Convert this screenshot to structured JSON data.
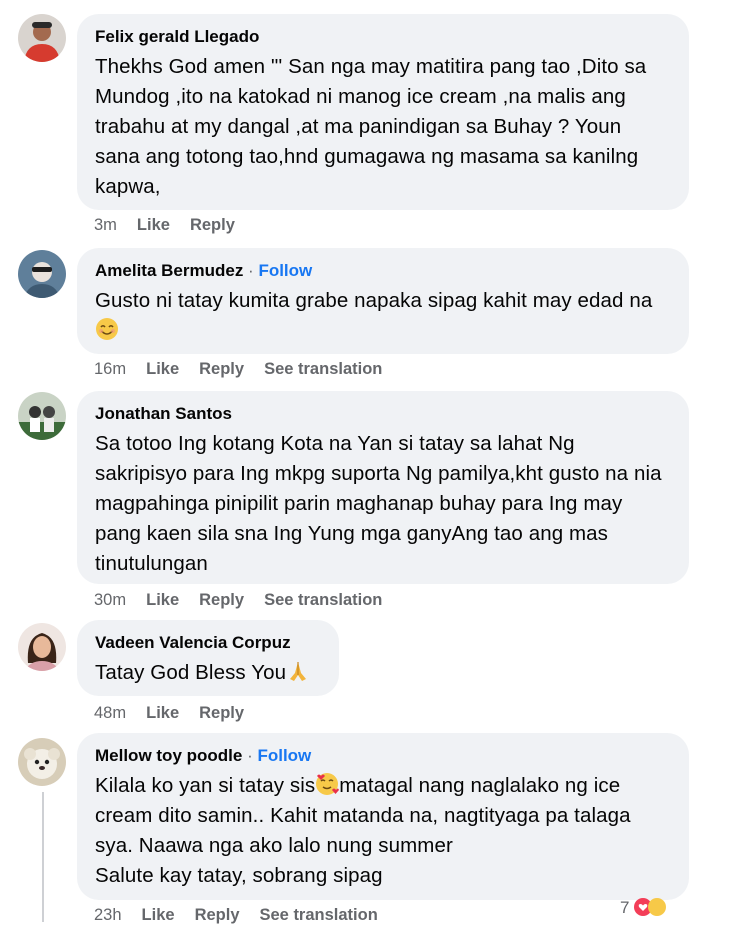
{
  "comments": [
    {
      "author": "Felix gerald Llegado",
      "follow": "",
      "text": "Thekhs God amen \"' San nga may matitira pang tao ,Dito sa Mundog ,ito na katokad ni manog ice cream ,na malis ang trabahu at my dangal ,at ma panindigan sa Buhay ? Youn sana ang totong tao,hnd gumagawa ng masama sa kanilng kapwa,",
      "time": "3m",
      "like": "Like",
      "reply": "Reply",
      "see_translation": ""
    },
    {
      "author": "Amelita Bermudez",
      "follow": "Follow",
      "text": "Gusto ni tatay kumita grabe napaka sipag kahit may edad na",
      "time": "16m",
      "like": "Like",
      "reply": "Reply",
      "see_translation": "See translation"
    },
    {
      "author": "Jonathan Santos",
      "follow": "",
      "text": "Sa totoo Ing kotang Kota na Yan si tatay sa lahat Ng sakripisyo para Ing mkpg suporta Ng pamilya,kht gusto na nia magpahinga pinipilit parin maghanap buhay para Ing may pang kaen sila sna Ing Yung mga ganyAng tao ang mas tinutulungan",
      "time": "30m",
      "like": "Like",
      "reply": "Reply",
      "see_translation": "See translation"
    },
    {
      "author": "Vadeen Valencia Corpuz",
      "follow": "",
      "text": "Tatay God Bless You",
      "time": "48m",
      "like": "Like",
      "reply": "Reply",
      "see_translation": ""
    },
    {
      "author": "Mellow toy poodle",
      "follow": "Follow",
      "text_line1": "Kilala ko yan si tatay sis",
      "text_rest": "matagal nang naglalako ng ice cream dito samin.. Kahit matanda na, nagtityaga pa talaga sya. Naawa nga ako lalo nung summer",
      "text_last": "Salute kay tatay, sobrang sipag",
      "time": "23h",
      "like": "Like",
      "reply": "Reply",
      "see_translation": "See translation",
      "reaction_count": "7"
    }
  ],
  "colors": {
    "bubble": "#f0f2f5",
    "link": "#1877f2",
    "meta": "#65676b"
  },
  "icons": [
    "smile-emoji",
    "praying-hands-emoji",
    "heart-face-emoji",
    "love-reaction-icon",
    "haha-reaction-icon"
  ]
}
